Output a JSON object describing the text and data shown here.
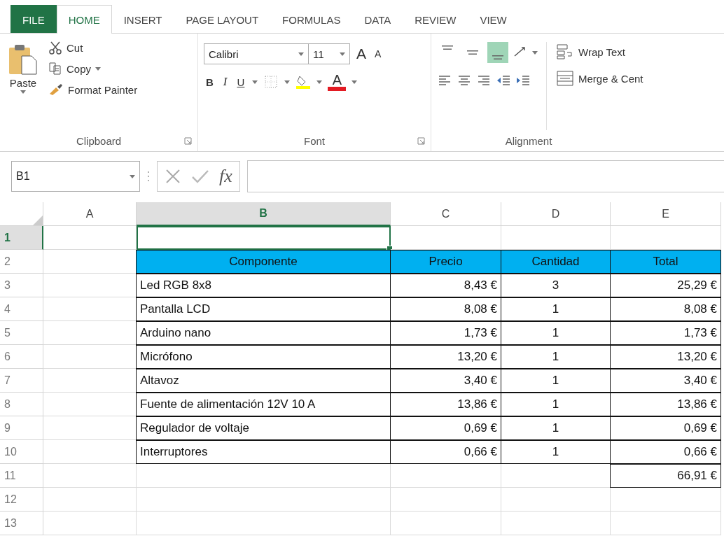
{
  "ribbon_tabs": [
    {
      "label": "FILE",
      "kind": "file",
      "selected": false
    },
    {
      "label": "HOME",
      "kind": "tab",
      "selected": true
    },
    {
      "label": "INSERT",
      "kind": "tab",
      "selected": false
    },
    {
      "label": "PAGE LAYOUT",
      "kind": "tab",
      "selected": false
    },
    {
      "label": "FORMULAS",
      "kind": "tab",
      "selected": false
    },
    {
      "label": "DATA",
      "kind": "tab",
      "selected": false
    },
    {
      "label": "REVIEW",
      "kind": "tab",
      "selected": false
    },
    {
      "label": "VIEW",
      "kind": "tab",
      "selected": false
    }
  ],
  "clipboard": {
    "paste": "Paste",
    "cut": "Cut",
    "copy": "Copy",
    "format_painter": "Format Painter",
    "label": "Clipboard"
  },
  "font": {
    "name": "Calibri",
    "size": "11",
    "grow": "A",
    "shrink": "A",
    "bold": "B",
    "italic": "I",
    "underline": "U",
    "font_color": "A",
    "label": "Font"
  },
  "alignment": {
    "vertical": [
      {
        "selected": false
      },
      {
        "selected": false
      },
      {
        "selected": true
      }
    ],
    "wrap_text": "Wrap Text",
    "merge": "Merge & Cent",
    "label": "Alignment"
  },
  "formula_bar": {
    "name_box": "B1",
    "function": "fx"
  },
  "columns": [
    {
      "label": "A",
      "selected": false
    },
    {
      "label": "B",
      "selected": true
    },
    {
      "label": "C",
      "selected": false
    },
    {
      "label": "D",
      "selected": false
    },
    {
      "label": "E",
      "selected": false
    }
  ],
  "rows": [
    {
      "number": "1",
      "selected": true,
      "kind": "blank"
    },
    {
      "number": "2",
      "selected": false,
      "kind": "header",
      "b": "Componente",
      "c": "Precio",
      "d": "Cantidad",
      "e": "Total"
    },
    {
      "number": "3",
      "selected": false,
      "kind": "item",
      "b": "Led RGB 8x8",
      "c": "8,43 €",
      "d": "3",
      "e": "25,29 €"
    },
    {
      "number": "4",
      "selected": false,
      "kind": "item",
      "b": "Pantalla LCD",
      "c": "8,08 €",
      "d": "1",
      "e": "8,08 €"
    },
    {
      "number": "5",
      "selected": false,
      "kind": "item",
      "b": "Arduino nano",
      "c": "1,73 €",
      "d": "1",
      "e": "1,73 €"
    },
    {
      "number": "6",
      "selected": false,
      "kind": "item",
      "b": "Micrófono",
      "c": "13,20 €",
      "d": "1",
      "e": "13,20 €"
    },
    {
      "number": "7",
      "selected": false,
      "kind": "item",
      "b": "Altavoz",
      "c": "3,40 €",
      "d": "1",
      "e": "3,40 €"
    },
    {
      "number": "8",
      "selected": false,
      "kind": "item",
      "b": "Fuente de alimentación 12V 10 A",
      "c": "13,86 €",
      "d": "1",
      "e": "13,86 €"
    },
    {
      "number": "9",
      "selected": false,
      "kind": "item",
      "b": "Regulador de voltaje",
      "c": "0,69 €",
      "d": "1",
      "e": "0,69 €"
    },
    {
      "number": "10",
      "selected": false,
      "kind": "item",
      "b": "Interruptores",
      "c": "0,66 €",
      "d": "1",
      "e": "0,66 €"
    },
    {
      "number": "11",
      "selected": false,
      "kind": "total",
      "e": "66,91 €"
    },
    {
      "number": "12",
      "selected": false,
      "kind": "blank"
    },
    {
      "number": "13",
      "selected": false,
      "kind": "blank"
    }
  ]
}
